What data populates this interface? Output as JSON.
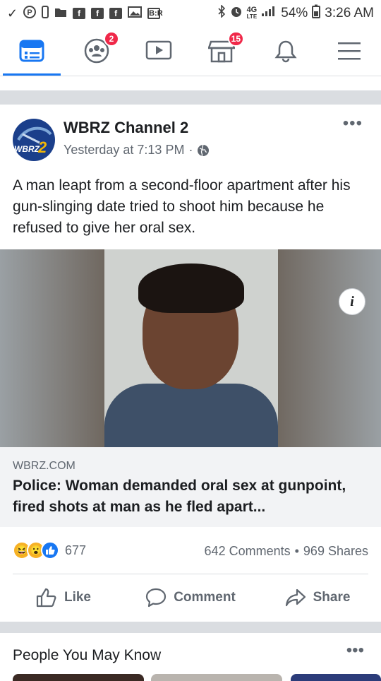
{
  "status_bar": {
    "left_icons": [
      "check-icon",
      "pinterest-icon",
      "phone-icon",
      "folder-icon",
      "facebook-icon",
      "facebook-icon",
      "facebook-icon",
      "gallery-icon",
      "br-icon"
    ],
    "br_label": "B:R",
    "network": "4G",
    "network_sub": "LTE",
    "battery": "54%",
    "time": "3:26 AM"
  },
  "nav": {
    "groups_badge": "2",
    "marketplace_badge": "15",
    "active_color": "#1877f2"
  },
  "post": {
    "page_name": "WBRZ Channel 2",
    "avatar_text": "WBRZ",
    "avatar_number": "2",
    "timestamp": "Yesterday at 7:13 PM",
    "separator": "·",
    "more_label": "•••",
    "text": "A man leapt from a second-floor apartment after his gun-slinging date tried to shoot him because he refused to give her oral sex.",
    "link": {
      "info_label": "i",
      "domain": "WBRZ.COM",
      "title": "Police: Woman demanded oral sex at gunpoint, fired shots at man as he fled apart..."
    },
    "reactions": {
      "types": [
        "haha",
        "wow",
        "like"
      ],
      "count": "677"
    },
    "comments": "642 Comments",
    "dot": "•",
    "shares": "969 Shares",
    "actions": {
      "like": "Like",
      "comment": "Comment",
      "share": "Share"
    }
  },
  "people_you_may_know": {
    "title": "People You May Know",
    "more_label": "•••"
  }
}
